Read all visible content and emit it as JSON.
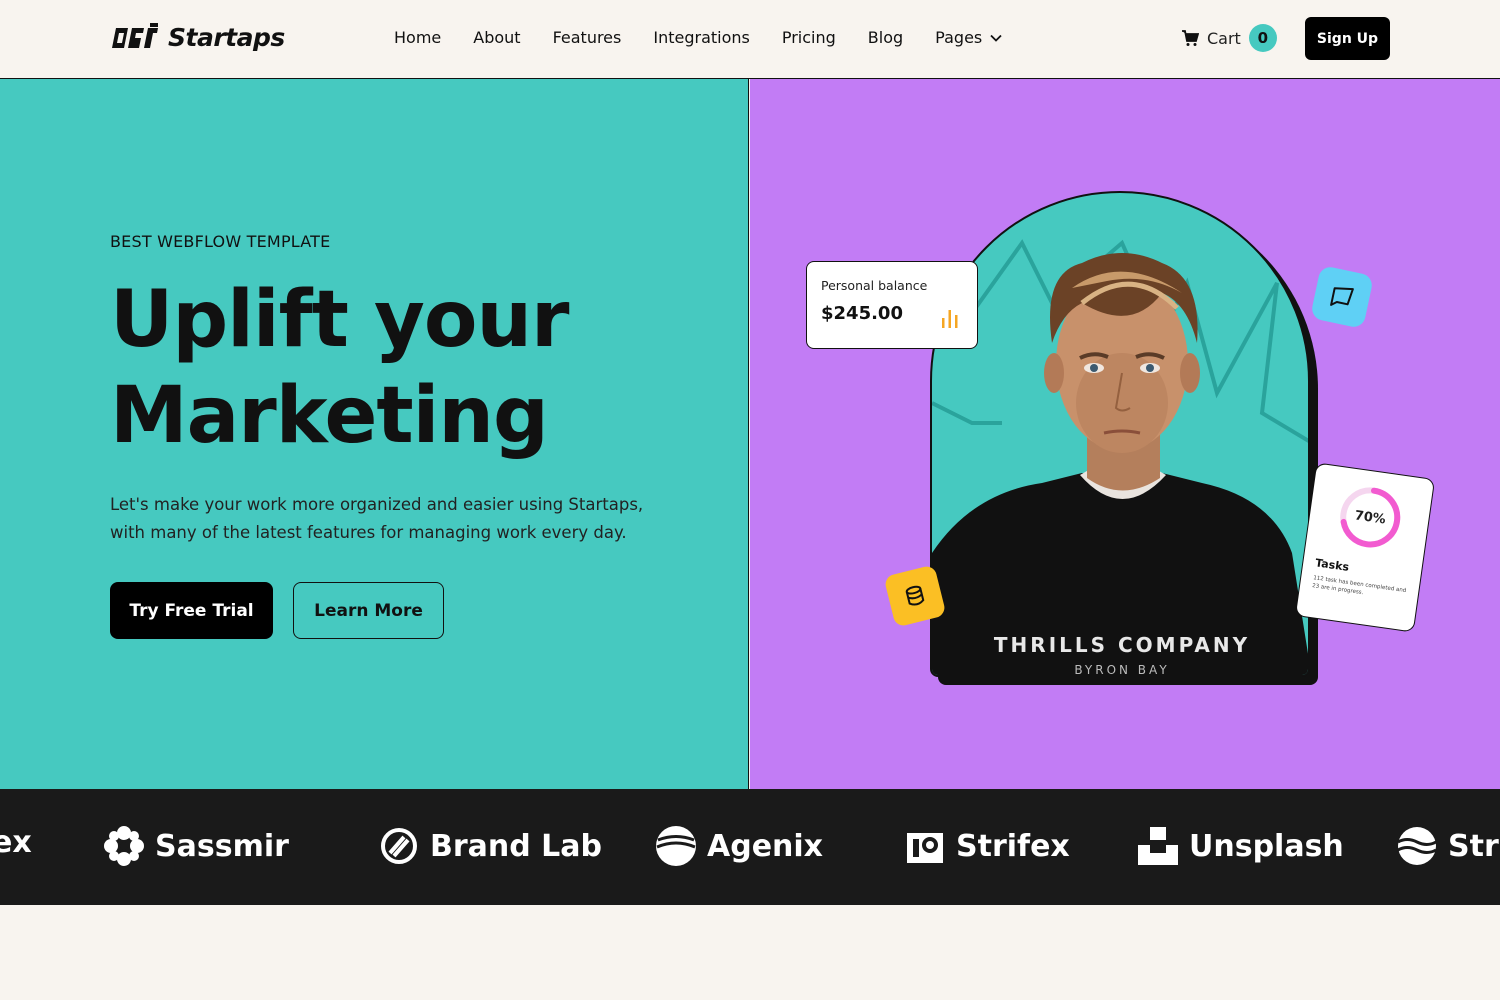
{
  "nav": {
    "logo_text": "Startaps",
    "items": [
      {
        "label": "Home"
      },
      {
        "label": "About"
      },
      {
        "label": "Features"
      },
      {
        "label": "Integrations"
      },
      {
        "label": "Pricing"
      },
      {
        "label": "Blog"
      },
      {
        "label": "Pages"
      }
    ],
    "cart_label": "Cart",
    "cart_count": "0",
    "signup_label": "Sign Up"
  },
  "hero": {
    "eyebrow": "BEST WEBFLOW TEMPLATE",
    "headline_line1": "Uplift your",
    "headline_line2": "Marketing",
    "description": "Let's make your work more organized and easier using Startaps, with many of the latest features for managing work every day.",
    "primary_button": "Try Free Trial",
    "secondary_button": "Learn More",
    "colors": {
      "left_bg": "#46c9c0",
      "right_bg": "#c27cf5",
      "accent_pink": "#f25bd0",
      "accent_yellow": "#fbbf24",
      "accent_blue": "#5fd0f5"
    }
  },
  "visual": {
    "balance_label": "Personal balance",
    "balance_value": "$245.00",
    "tasks_percent": "70%",
    "tasks_progress": 0.7,
    "tasks_title": "Tasks",
    "tasks_desc": "112 task has been completed and 23 are in progress.",
    "shirt_text": "THRILLS COMPANY",
    "shirt_sub": "BYRON BAY"
  },
  "brands": [
    {
      "name": "ex",
      "icon": "strifex-icon"
    },
    {
      "name": "Sassmir",
      "icon": "sassmir-icon"
    },
    {
      "name": "Brand Lab",
      "icon": "brandlab-icon"
    },
    {
      "name": "Agenix",
      "icon": "agenix-icon"
    },
    {
      "name": "Strifex",
      "icon": "strifex-icon"
    },
    {
      "name": "Unsplash",
      "icon": "unsplash-icon"
    },
    {
      "name": "Stri",
      "icon": "waves-icon"
    }
  ]
}
